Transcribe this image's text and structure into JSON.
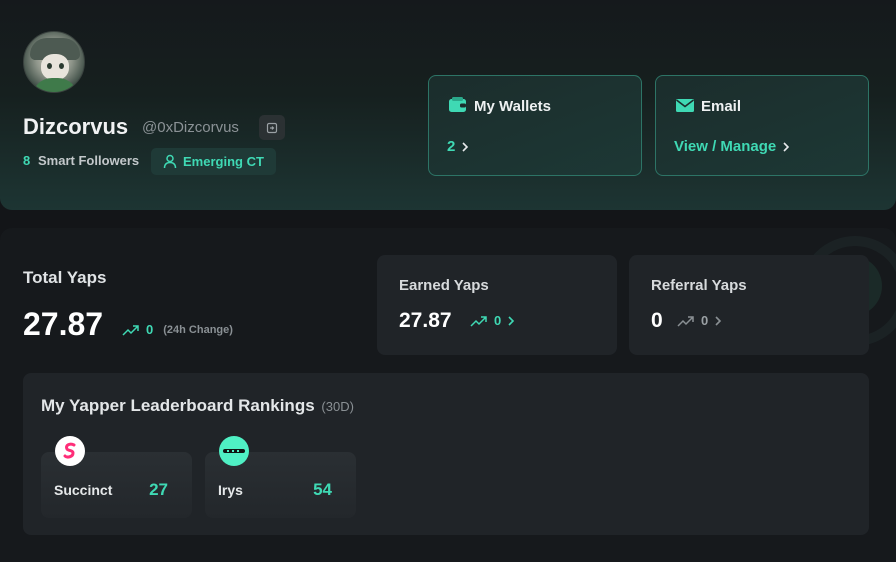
{
  "profile": {
    "name": "Dizcorvus",
    "handle": "@0xDizcorvus",
    "smart_followers_count": "8",
    "smart_followers_label": "Smart Followers",
    "badge_label": "Emerging CT"
  },
  "wallets": {
    "title": "My Wallets",
    "value": "2"
  },
  "email": {
    "title": "Email",
    "link": "View / Manage"
  },
  "yaps": {
    "total_label": "Total Yaps",
    "total_value": "27.87",
    "total_change": "0",
    "total_change_note": "(24h Change)",
    "earned_label": "Earned Yaps",
    "earned_value": "27.87",
    "earned_change": "0",
    "referral_label": "Referral Yaps",
    "referral_value": "0",
    "referral_change": "0"
  },
  "rankings": {
    "title": "My Yapper Leaderboard Rankings",
    "period": "(30D)",
    "items": [
      {
        "name": "Succinct",
        "rank": "27",
        "icon": "succinct-logo-icon"
      },
      {
        "name": "Irys",
        "rank": "54",
        "icon": "irys-logo-icon"
      }
    ]
  },
  "colors": {
    "accent": "#3fd9b4",
    "background": "#131518",
    "card": "#202428"
  }
}
